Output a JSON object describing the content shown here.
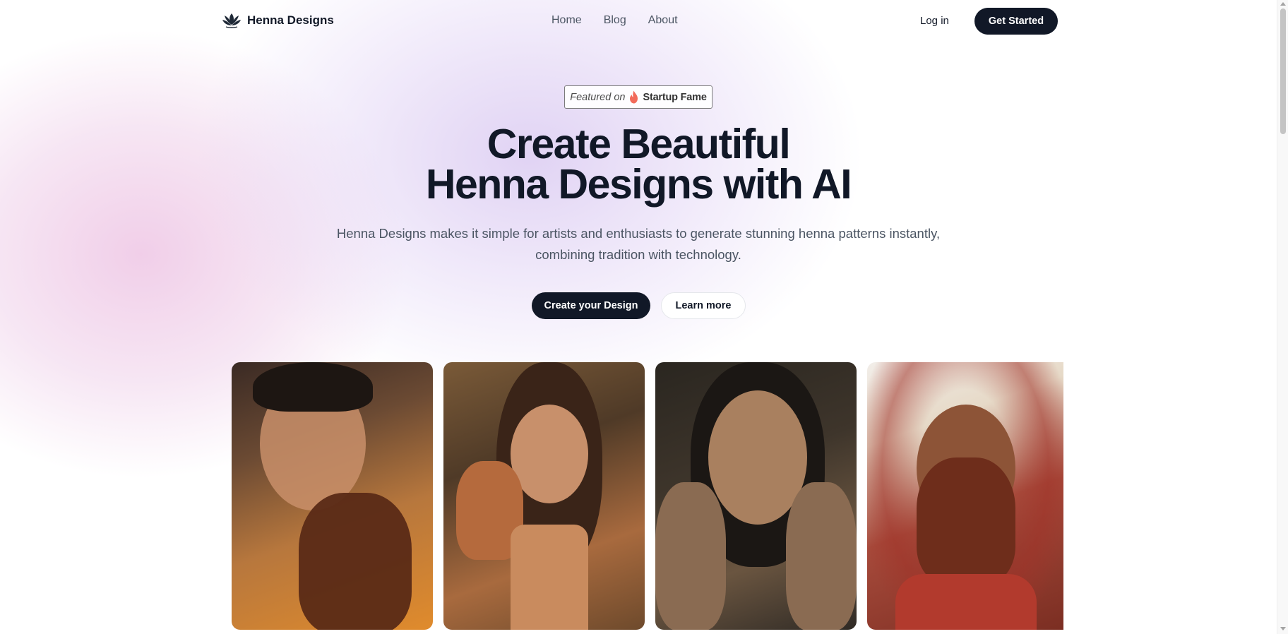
{
  "nav": {
    "brand": "Henna Designs",
    "links": [
      "Home",
      "Blog",
      "About"
    ],
    "login": "Log in",
    "cta": "Get Started"
  },
  "badge": {
    "prefix": "Featured on",
    "brand": "Startup Fame"
  },
  "hero": {
    "title_line1": "Create Beautiful",
    "title_line2": "Henna Designs with AI",
    "subtitle_line1": "Henna Designs makes it simple for artists and enthusiasts to generate stunning henna patterns instantly,",
    "subtitle_line2": "combining tradition with technology.",
    "primary_button": "Create your Design",
    "secondary_button": "Learn more"
  },
  "gallery": {
    "images": [
      "woman-with-henna-hand-orange-background",
      "smiling-woman-with-henna-hand",
      "woman-with-henna-hands-and-rings",
      "bride-covering-face-with-henna-hands"
    ]
  },
  "colors": {
    "primary": "#111827",
    "text_muted": "#4b5563",
    "glow_pink": "#ecbee1",
    "glow_violet": "#d6c4f0",
    "badge_flame": "#f26b5b"
  }
}
